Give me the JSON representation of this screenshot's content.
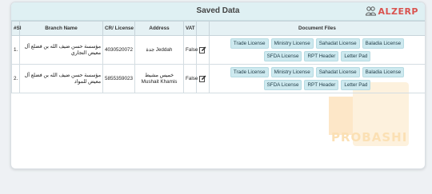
{
  "header": {
    "title": "Saved Data",
    "logo_text": "ALZERP"
  },
  "columns": [
    "#Sl",
    "Branch Name",
    "CR/ License",
    "Address",
    "VAT",
    "",
    "Document Files"
  ],
  "rows": [
    {
      "num": "1.",
      "branch": "مؤسسة حسن ضيف الله بن فضلع آل معيض التجاري",
      "cr": "4030520072",
      "address": "جدة Jeddah",
      "vat": "False",
      "docs": [
        "Trade License",
        "Ministry License",
        "Sahadat License",
        "Baladia License",
        "SFDA License",
        "RPT Header",
        "Letter Pad"
      ]
    },
    {
      "num": "2.",
      "branch": "مؤسسة حسن ضيف الله بن فضلع آل معيض للمواد",
      "cr": "5855359023",
      "address": "خميس مشيط Mushait Khamis",
      "vat": "False",
      "docs": [
        "Trade License",
        "Ministry License",
        "Sahadat License",
        "Baladia License",
        "SFDA License",
        "RPT Header",
        "Letter Pad"
      ]
    }
  ],
  "watermark": {
    "text": "PROBASHI",
    "letters": "DLO"
  },
  "colors": {
    "header_bg": "#dff0f3",
    "doc_button_bg": "#cde9ef",
    "logo": "#d9534f",
    "watermark": "#fde7c8"
  }
}
